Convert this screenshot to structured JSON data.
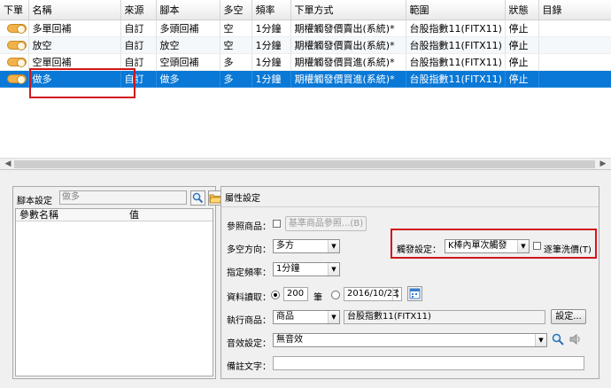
{
  "grid": {
    "columns": [
      "下單",
      "名稱",
      "來源",
      "腳本",
      "多空",
      "頻率",
      "下單方式",
      "範圍",
      "狀態",
      "目錄"
    ],
    "rows": [
      {
        "name": "多單回補",
        "source": "自訂",
        "script": "多頭回補",
        "direction": "空",
        "freq": "1分鐘",
        "order_method": "期權觸發價賣出(系統)*",
        "scope": "台股指數11(FITX11)",
        "status": "停止",
        "folder": ""
      },
      {
        "name": "放空",
        "source": "自訂",
        "script": "放空",
        "direction": "空",
        "freq": "1分鐘",
        "order_method": "期權觸發價賣出(系統)*",
        "scope": "台股指數11(FITX11)",
        "status": "停止",
        "folder": ""
      },
      {
        "name": "空單回補",
        "source": "自訂",
        "script": "空頭回補",
        "direction": "多",
        "freq": "1分鐘",
        "order_method": "期權觸發價買進(系統)*",
        "scope": "台股指數11(FITX11)",
        "status": "停止",
        "folder": ""
      },
      {
        "name": "做多",
        "source": "自訂",
        "script": "做多",
        "direction": "多",
        "freq": "1分鐘",
        "order_method": "期權觸發價買進(系統)*",
        "scope": "台股指數11(FITX11)",
        "status": "停止",
        "folder": ""
      }
    ],
    "selected_row": 3
  },
  "left_panel": {
    "script_label": "腳本設定",
    "script_value": "做多",
    "param_name_header": "參數名稱",
    "param_value_header": "值"
  },
  "right_panel": {
    "title": "屬性設定",
    "ref_label": "參照商品：",
    "ref_button": "基準商品參照...(B)",
    "direction_label": "多空方向：",
    "direction_value": "多方",
    "trigger_label": "觸發設定：",
    "trigger_value": "K棒內單次觸發",
    "per_trade_label": "逐筆洗價(T)",
    "freq_label": "指定頻率：",
    "freq_value": "1分鐘",
    "data_label": "資料讀取：",
    "bars_value": "200",
    "bars_unit": "筆",
    "date_value": "2016/10/23",
    "exec_label": "執行商品：",
    "exec_type": "商品",
    "exec_symbol": "台股指數11(FITX11)",
    "settings_button": "設定...",
    "sound_label": "音效設定：",
    "sound_value": "無音效",
    "note_label": "備註文字："
  },
  "colors": {
    "selection": "#0a78d6",
    "highlight_box": "#d0161a",
    "toggle": "#f2b24a"
  }
}
